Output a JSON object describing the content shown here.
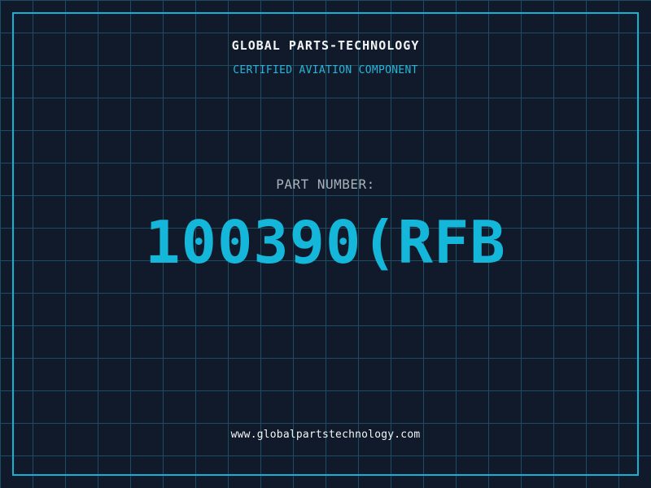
{
  "header": {
    "company_name": "GLOBAL PARTS-TECHNOLOGY",
    "subtitle": "CERTIFIED AVIATION COMPONENT"
  },
  "part": {
    "label": "PART NUMBER:",
    "number": "100390(RFB"
  },
  "footer": {
    "website": "www.globalpartstechnology.com"
  },
  "colors": {
    "background": "#101a2b",
    "grid_line": "#1c4e63",
    "frame": "#12b1d6",
    "accent_cyan": "#2ab5d8",
    "part_cyan": "#14b7d9",
    "white_text": "#f2f5f6",
    "gray_text": "#a9b2ba"
  }
}
